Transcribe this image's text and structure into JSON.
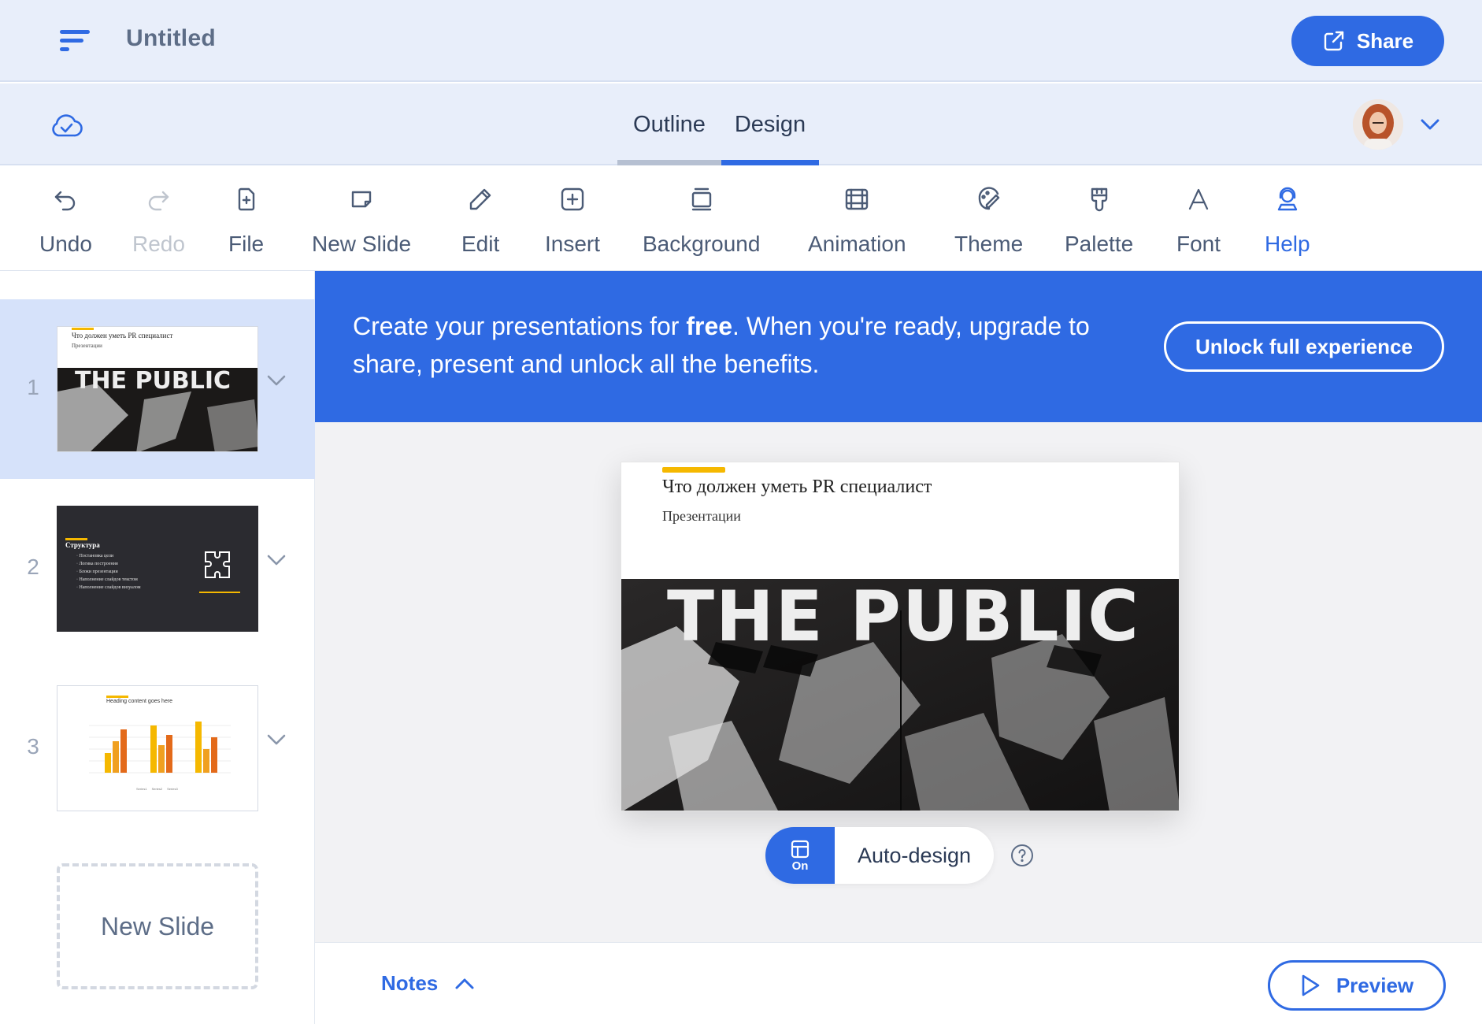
{
  "header": {
    "title": "Untitled",
    "share_label": "Share"
  },
  "nav": {
    "tabs": [
      {
        "label": "Outline",
        "active": false
      },
      {
        "label": "Design",
        "active": true
      }
    ]
  },
  "toolbar": {
    "items": [
      {
        "label": "Undo",
        "icon": "undo-icon",
        "enabled": true
      },
      {
        "label": "Redo",
        "icon": "redo-icon",
        "enabled": false
      },
      {
        "label": "File",
        "icon": "file-icon",
        "enabled": true
      },
      {
        "label": "New Slide",
        "icon": "new-slide-icon",
        "enabled": true
      },
      {
        "label": "Edit",
        "icon": "pencil-icon",
        "enabled": true
      },
      {
        "label": "Insert",
        "icon": "insert-icon",
        "enabled": true
      },
      {
        "label": "Background",
        "icon": "background-icon",
        "enabled": true
      },
      {
        "label": "Animation",
        "icon": "animation-icon",
        "enabled": true
      },
      {
        "label": "Theme",
        "icon": "theme-icon",
        "enabled": true
      },
      {
        "label": "Palette",
        "icon": "palette-icon",
        "enabled": true
      },
      {
        "label": "Font",
        "icon": "font-icon",
        "enabled": true
      },
      {
        "label": "Help",
        "icon": "help-icon",
        "enabled": true
      }
    ]
  },
  "banner": {
    "text_before": "Create your presentations for ",
    "text_bold": "free",
    "text_after": ". When you're ready, upgrade to share, present and unlock all the benefits.",
    "button_label": "Unlock full experience"
  },
  "slides": [
    {
      "number": "1",
      "active": true,
      "title": "Что должен уметь PR специалист",
      "subtitle": "Презентации",
      "image_text": "THE PUBLIC"
    },
    {
      "number": "2",
      "active": false,
      "title": "Структура",
      "bullets": [
        "Постановка цели",
        "Логика построения",
        "Блоки презентации",
        "Наполнение слайдов текстом",
        "Наполнение слайдов визуалом"
      ]
    },
    {
      "number": "3",
      "active": false,
      "title": "Heading content goes here",
      "legend": [
        "Series1",
        "Series2",
        "Series3"
      ]
    }
  ],
  "new_slide_label": "New Slide",
  "main_slide": {
    "title": "Что должен уметь PR специалист",
    "subtitle": "Презентации",
    "image_text": "THE PUBLIC"
  },
  "auto_design": {
    "state": "On",
    "label": "Auto-design"
  },
  "footer": {
    "notes_label": "Notes",
    "preview_label": "Preview"
  },
  "colors": {
    "accent": "#2f6ae3",
    "header_bg": "#e8eefa",
    "slide_accent": "#f5b800"
  }
}
